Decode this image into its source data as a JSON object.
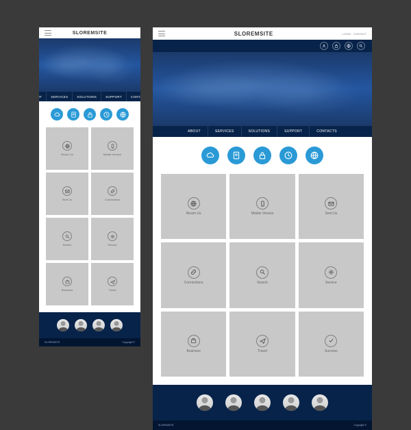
{
  "brand": "SLOREMSITE",
  "toplinks": [
    "LOGIN",
    "CONTACT"
  ],
  "nav": [
    "ABOUT",
    "SERVICES",
    "SOLUTIONS",
    "SUPPORT",
    "CONTACTS"
  ],
  "feature_icons": [
    "cloud",
    "file",
    "lock",
    "clock",
    "globe"
  ],
  "cards": [
    {
      "icon": "globe",
      "label": "Reach Us"
    },
    {
      "icon": "phone",
      "label": "Mobile Version"
    },
    {
      "icon": "mail",
      "label": "Sent Us"
    },
    {
      "icon": "link",
      "label": "Connections"
    },
    {
      "icon": "search",
      "label": "Search"
    },
    {
      "icon": "gear",
      "label": "Service"
    },
    {
      "icon": "briefcase",
      "label": "Business"
    },
    {
      "icon": "plane",
      "label": "Travel"
    },
    {
      "icon": "check",
      "label": "Success"
    }
  ],
  "footer": {
    "left": "SLOREMSITE",
    "right": "Copyright ©"
  },
  "colors": {
    "brand": "#2a9ad6",
    "navy": "#07234a"
  }
}
